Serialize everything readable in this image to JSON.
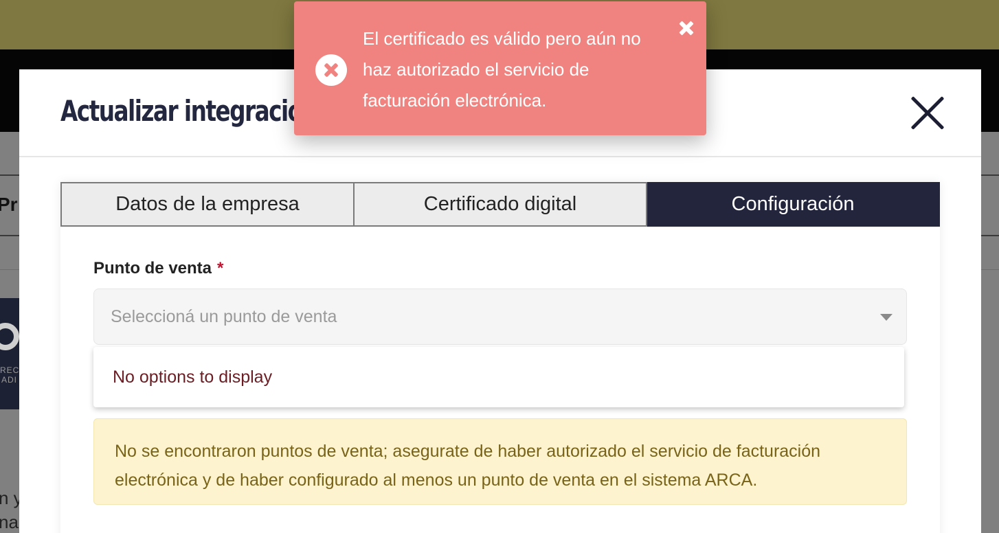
{
  "background": {
    "partial_heading": "Pr",
    "logo_text_line1": "RECA",
    "logo_text_line2": "ADI",
    "side_text_line1": "n y",
    "side_text_line2": "na"
  },
  "modal": {
    "title": "Actualizar integración",
    "tabs": [
      {
        "label": "Datos de la empresa",
        "active": false
      },
      {
        "label": "Certificado digital",
        "active": false
      },
      {
        "label": "Configuración",
        "active": true
      }
    ],
    "field": {
      "label": "Punto de venta",
      "required_marker": "*",
      "placeholder": "Seleccioná un punto de venta"
    },
    "dropdown": {
      "empty_message": "No options to display"
    },
    "warning_message": "No se encontraron puntos de venta; asegurate de haber autorizado el servicio de facturación electrónica y de haber configurado al menos un punto de venta en el sistema ARCA."
  },
  "toast": {
    "type": "error",
    "icon": "error-circle-icon",
    "message": "El certificado es válido pero aún no haz autorizado el servicio de facturación electrónica."
  },
  "colors": {
    "toast_bg": "#f0837f",
    "active_tab": "#23253d",
    "warning_bg": "#fdf4cf",
    "warning_text": "#786318",
    "required": "#c8102e"
  }
}
